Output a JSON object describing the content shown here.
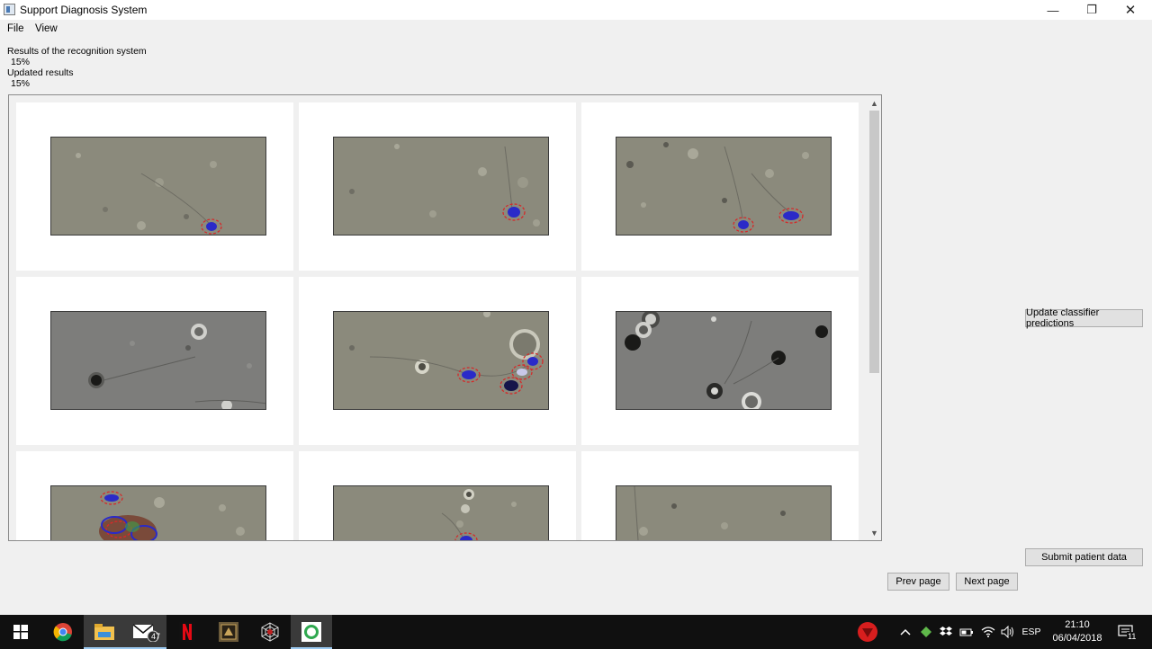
{
  "window": {
    "title": "Support Diagnosis System",
    "minimize_glyph": "—",
    "maximize_glyph": "❐",
    "close_glyph": "✕"
  },
  "menu": {
    "file": "File",
    "view": "View"
  },
  "results": {
    "recognition_label": "Results of the recognition system",
    "recognition_value": "15%",
    "updated_label": "Updated results",
    "updated_value": "15%"
  },
  "buttons": {
    "update": "Update classifier predictions",
    "submit": "Submit patient data",
    "prev": "Prev page",
    "next": "Next page"
  },
  "taskbar": {
    "mail_badge": "47",
    "language": "ESP",
    "time": "21:10",
    "date": "06/04/2018",
    "notifications": "11"
  },
  "colors": {
    "detection_outline": "#d42a2a",
    "detection_fill": "#2a2ac8",
    "accent": "#0078d7"
  }
}
